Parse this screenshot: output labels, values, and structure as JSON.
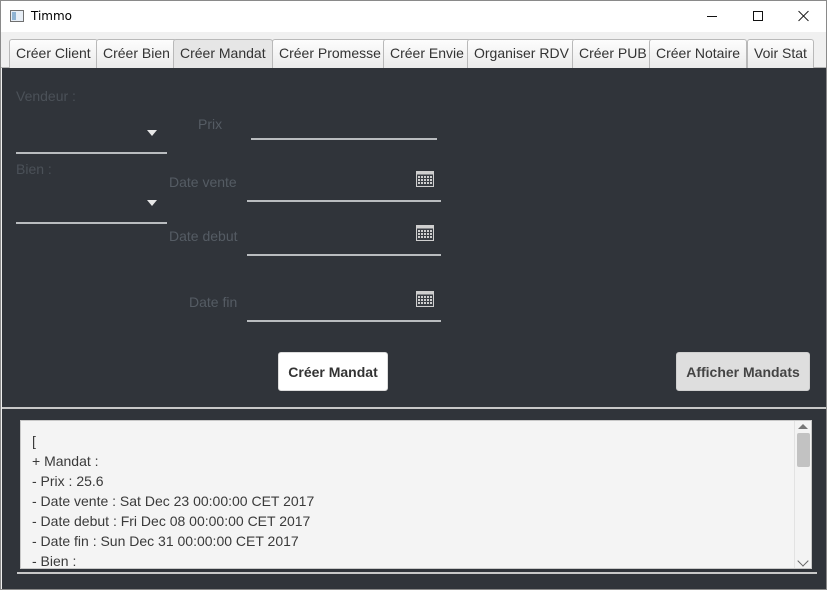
{
  "window": {
    "title": "Timmo",
    "icon": "app-window-icon"
  },
  "tabs": [
    {
      "label": "Créer Client",
      "selected": false
    },
    {
      "label": "Créer Bien",
      "selected": false
    },
    {
      "label": "Créer Mandat",
      "selected": true
    },
    {
      "label": "Créer Promesse",
      "selected": false
    },
    {
      "label": "Créer Envie",
      "selected": false
    },
    {
      "label": "Organiser RDV",
      "selected": false
    },
    {
      "label": "Créer PUB",
      "selected": false
    },
    {
      "label": "Créer Notaire",
      "selected": false
    },
    {
      "label": "Voir Stat",
      "selected": false
    }
  ],
  "form": {
    "vendeur_label": "Vendeur :",
    "vendeur_value": "",
    "bien_label": "Bien :",
    "bien_value": "",
    "prix_label": "Prix",
    "prix_value": "",
    "date_vente_label": "Date vente",
    "date_vente_value": "",
    "date_debut_label": "Date debut",
    "date_debut_value": "",
    "date_fin_label": "Date fin",
    "date_fin_value": ""
  },
  "buttons": {
    "create_label": "Créer Mandat",
    "show_label": "Afficher Mandats"
  },
  "output": {
    "lines": [
      "[",
      "+ Mandat :",
      "- Prix : 25.6",
      "- Date vente : Sat Dec 23 00:00:00 CET 2017",
      "- Date debut : Fri Dec 08 00:00:00 CET 2017",
      "- Date fin : Sun Dec 31 00:00:00 CET 2017",
      "- Bien :"
    ]
  },
  "colors": {
    "panel_background": "#30343a",
    "label_text": "#555c64",
    "field_underline": "#b9bcbf",
    "output_background": "#f4f4f4"
  }
}
